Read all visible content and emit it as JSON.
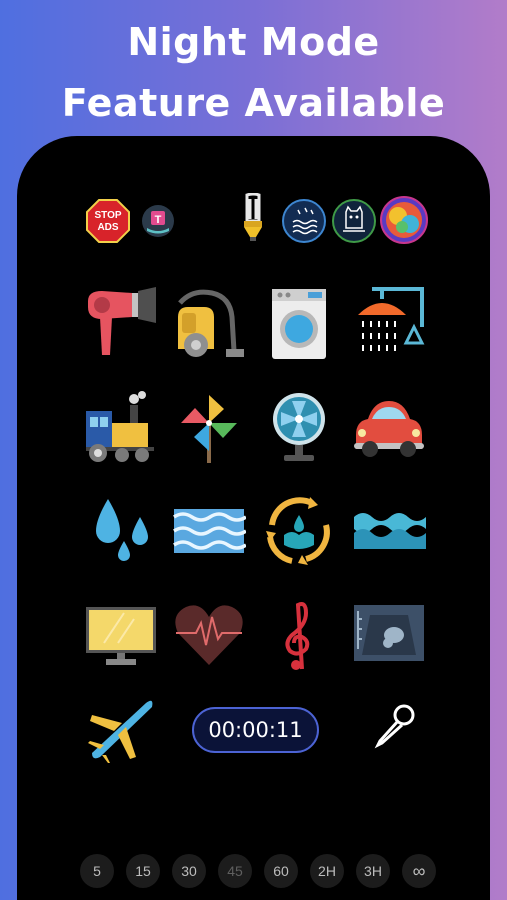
{
  "promo": {
    "line1": "Night Mode",
    "line2": "Feature Available"
  },
  "top_row": {
    "stop_ads": "STOP ADS",
    "badge_letter": "T"
  },
  "timer": {
    "value": "00:00:11"
  },
  "durations": [
    {
      "label": "5",
      "enabled": true
    },
    {
      "label": "15",
      "enabled": true
    },
    {
      "label": "30",
      "enabled": true
    },
    {
      "label": "45",
      "enabled": false
    },
    {
      "label": "60",
      "enabled": true
    },
    {
      "label": "2H",
      "enabled": true
    },
    {
      "label": "3H",
      "enabled": true
    },
    {
      "label": "∞",
      "enabled": true
    }
  ],
  "sounds": [
    "hair-dryer",
    "vacuum-cleaner",
    "washing-machine",
    "shower",
    "train",
    "pinwheel",
    "fan",
    "car",
    "water-drops",
    "waves",
    "water-cycle",
    "ocean",
    "tv",
    "heartbeat",
    "music",
    "ultrasound",
    "airplane",
    "microphone"
  ]
}
